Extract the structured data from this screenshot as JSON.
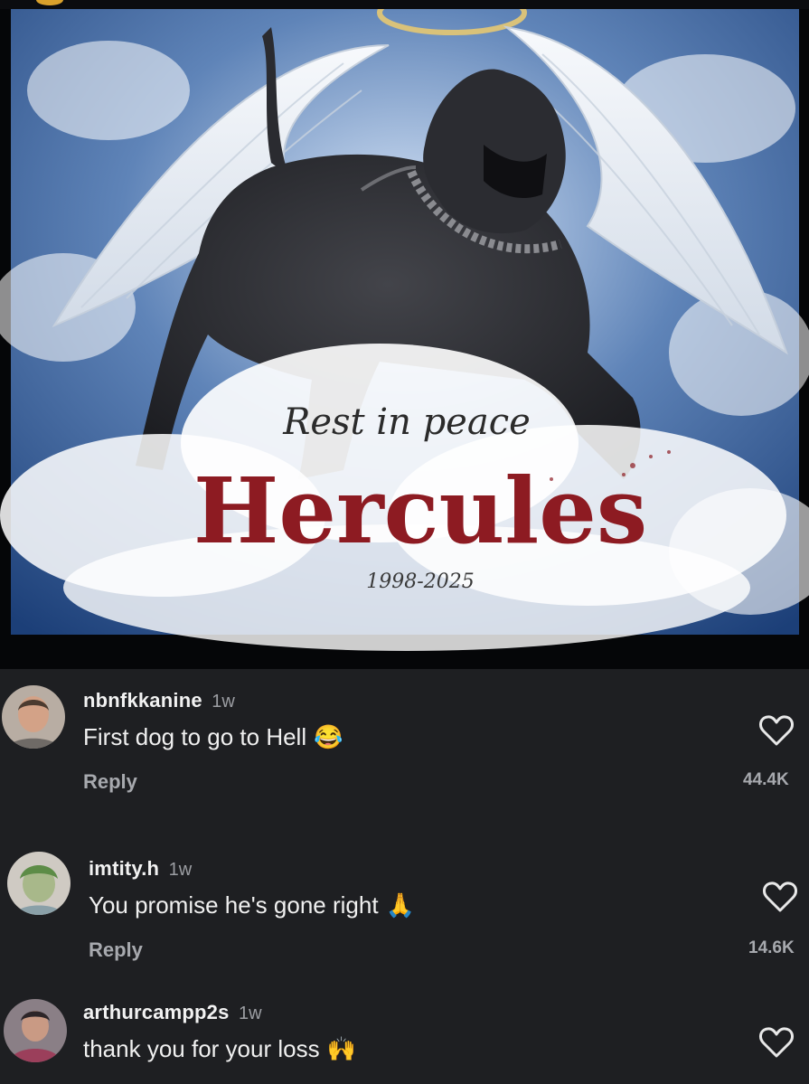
{
  "post": {
    "image_text": {
      "subtitle": "Rest in peace",
      "name": "Hercules",
      "years": "1998-2025"
    }
  },
  "comments": [
    {
      "username": "nbnfkkanine",
      "time": "1w",
      "text": "First dog to go to Hell",
      "emoji": "😂",
      "reply_label": "Reply",
      "like_icon": "heart-outline-icon",
      "likes": "44.4K"
    },
    {
      "username": "imtity.h",
      "time": "1w",
      "text": "You promise he's gone right",
      "emoji": "🙏",
      "reply_label": "Reply",
      "like_icon": "heart-outline-icon",
      "likes": "14.6K"
    },
    {
      "username": "arthurcampp2s",
      "time": "1w",
      "text": "thank you for your loss",
      "emoji": "🙌",
      "like_icon": "heart-outline-icon"
    }
  ],
  "colors": {
    "background": "#1e1f22",
    "text": "#f0f0f0",
    "secondary_text": "#a7a9ae",
    "title_red": "#8d1b22"
  }
}
